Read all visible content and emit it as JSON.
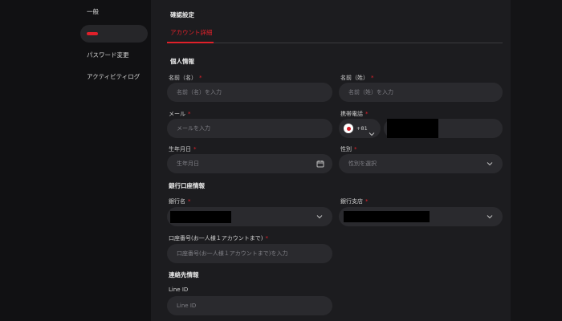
{
  "sidebar": {
    "items": [
      {
        "label": "一般"
      },
      {
        "label": ""
      },
      {
        "label": "パスワード変更"
      },
      {
        "label": "アクティビティログ"
      }
    ]
  },
  "page_title": "確認設定",
  "tabs": [
    {
      "label": "アカウント詳細"
    }
  ],
  "personal": {
    "title": "個人情報",
    "first_name": {
      "label": "名前（名）",
      "placeholder": "名前（名）を入力"
    },
    "last_name": {
      "label": "名前（姓）",
      "placeholder": "名前（姓）を入力"
    },
    "email": {
      "label": "メール",
      "placeholder": "メールを入力"
    },
    "phone": {
      "label": "携帯電話",
      "prefix": "+81"
    },
    "birthdate": {
      "label": "生年月日",
      "placeholder": "生年月日"
    },
    "gender": {
      "label": "性別",
      "placeholder": "性別を選択"
    }
  },
  "bank": {
    "title": "銀行口座情報",
    "bank_name": {
      "label": "銀行名"
    },
    "branch": {
      "label": "銀行支店"
    },
    "account_no": {
      "label": "口座番号(お一人様１アカウントまで)",
      "placeholder": "口座番号(お一人様１アカウントまで)を入力"
    }
  },
  "contact": {
    "title": "連絡先情報",
    "line_id": {
      "label": "Line ID",
      "placeholder": "Line ID"
    }
  },
  "required_mark": "*",
  "colors": {
    "accent": "#e0202a",
    "background": "#1c1c1f",
    "field": "#2a2a2e"
  },
  "icons": {
    "select": "chevron-down-icon",
    "date": "calendar-icon",
    "flag": "japan-flag-icon"
  }
}
